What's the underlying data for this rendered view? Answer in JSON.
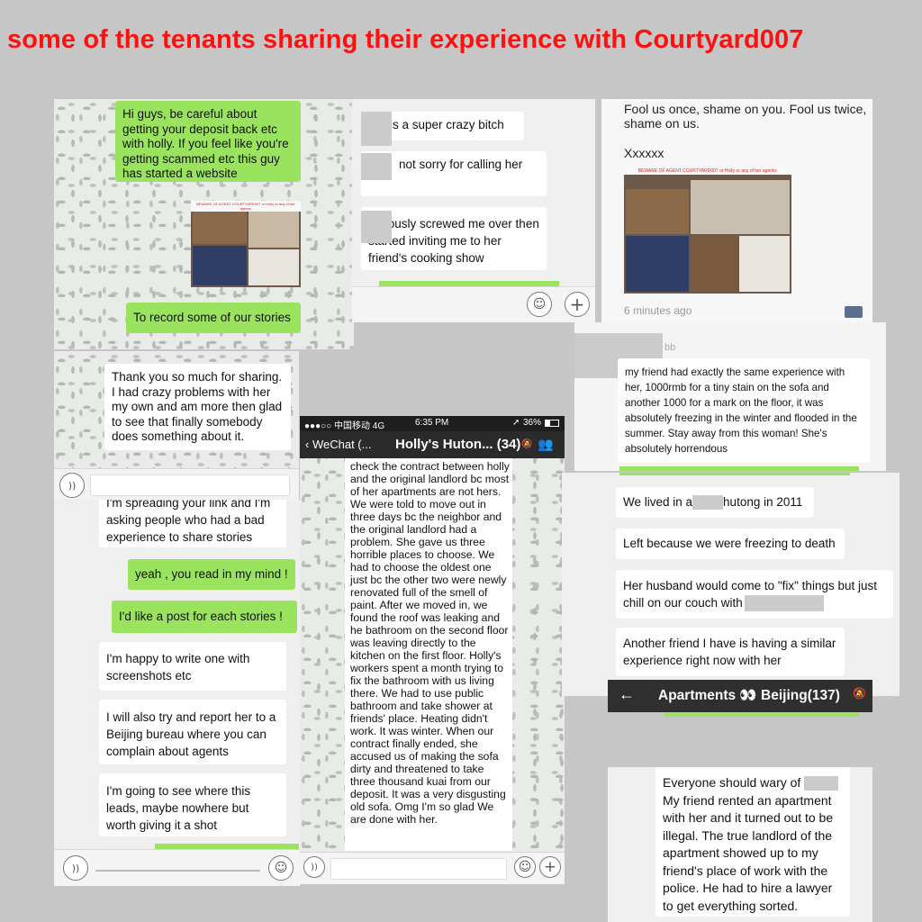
{
  "headline": "some of the tenants sharing their experience with Courtyard007",
  "shot1": {
    "msg1": "Hi guys, be careful about getting your deposit back etc with holly. If you feel like you're getting scammed etc this guy has started a website",
    "msg2": "To record some of our stories",
    "msg3": "Thank you so much for sharing. I had crazy problems with her my own and am more then glad to see that finally somebody does something about it."
  },
  "shot2": {
    "msg1": "is a super crazy bitch",
    "msg2": "not sorry for calling her",
    "msg3": "seriously screwed me over then started inviting me to her friend's cooking show"
  },
  "shot3": {
    "text1": "Fool us once, shame on you. Fool us twice, shame on us.",
    "text2": "Xxxxxx",
    "banner": "BEWARE OF AGENT COURTYARD007 or Holly or any of her agents:",
    "time": "6 minutes ago"
  },
  "shot4": {
    "sender": "bb",
    "msg": "my friend had exactly the same experience with her, 1000rmb for a tiny stain on the sofa and another 1000 for a mark on the floor, it was absolutely freezing in the winter and flooded in the summer. Stay away from this woman! She's absolutely horrendous"
  },
  "shot5": {
    "msg0": "I'm spreading your link and I'm asking people who had a bad experience to share stories",
    "msg1": "yeah , you read in my mind !",
    "msg2": "I'd like a post for each stories !",
    "msg3": "I'm happy to write one with screenshots etc",
    "msg4": "I will also try and report her to a Beijing bureau where you can complain about agents",
    "msg5": "I'm going to see where this leads, maybe nowhere but worth giving it a shot"
  },
  "phone": {
    "carrier": "●●●○○ 中国移动  4G",
    "time": "6:35 PM",
    "battery": "36%",
    "back": "WeChat (...",
    "title": "Holly's Huton... (34)",
    "text": "check the contract between holly and the original landlord bc most of her apartments are not hers. We were told to move out in three days bc the neighbor and the original landlord had a problem. She gave us three horrible places to choose. We had to choose the oldest one just bc the other two were newly renovated full of the smell of paint. After we moved in, we found the roof was leaking and he bathroom on the second floor was leaving directly to the kitchen on the first floor. Holly's workers spent a month trying to fix the bathroom with us living there. We had to use public bathroom and take shower at friends' place. Heating didn't work. It was winter. When our contract finally ended, she accused us of making the sofa dirty and threatened to take three thousand kuai from our deposit. It was a very disgusting old sofa. Omg I'm so glad We are done with her."
  },
  "shot6": {
    "msg1a": "We lived in a",
    "msg1b": "hutong in 2011",
    "msg2": "Left because we were freezing to death",
    "msg3": "Her husband would come to \"fix\" things but just chill on our couch with",
    "msg4": "Another friend I have is having a similar experience right now with her",
    "group": "Apartments 👀 Beijing(137)"
  },
  "shot7": {
    "line1": "Everyone should wary of",
    "rest": "My friend rented an apartment with her and it turned out to be illegal. The true landlord of the apartment showed up to my friend's place of work with the police. He had to hire a lawyer to get everything sorted."
  }
}
